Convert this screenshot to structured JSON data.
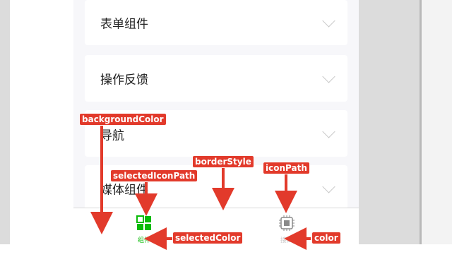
{
  "cards": [
    {
      "label": "表单组件"
    },
    {
      "label": "操作反馈"
    },
    {
      "label": "导航"
    },
    {
      "label": "媒体组件"
    }
  ],
  "tabbar": {
    "tabs": [
      {
        "label": "组件",
        "icon": "grid-icon",
        "selected": true
      },
      {
        "label": "接口",
        "icon": "chip-icon",
        "selected": false
      }
    ],
    "selected_color": "#09bb07",
    "color": "#cccccc"
  },
  "annotations": {
    "background_color": "backgroundColor",
    "selected_icon_path": "selectedIconPath",
    "border_style": "borderStyle",
    "icon_path": "iconPath",
    "selected_color": "selectedColor",
    "color": "color"
  },
  "colors": {
    "annotation": "#e23a2b",
    "page_background": "#f7f7fa"
  }
}
